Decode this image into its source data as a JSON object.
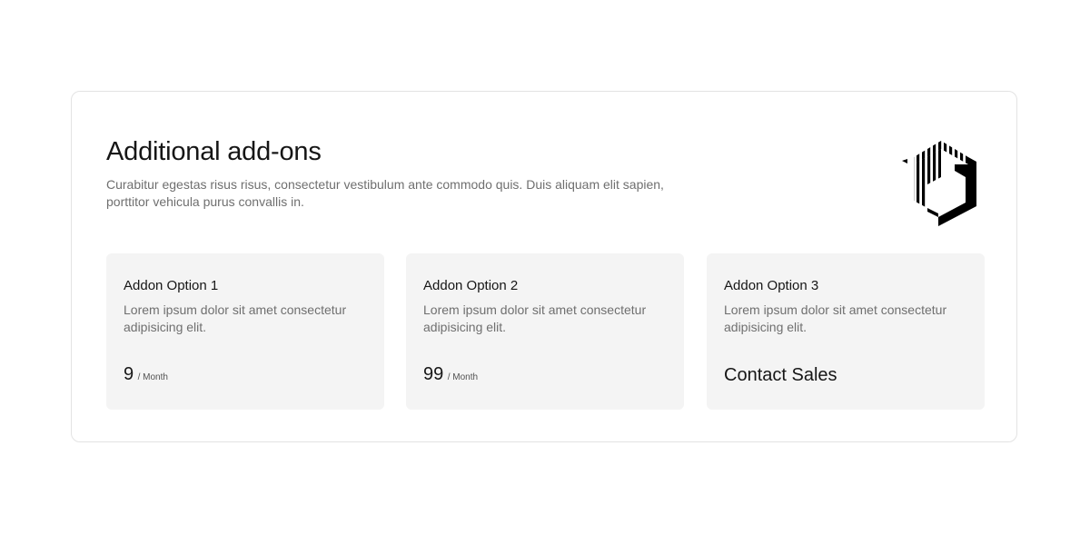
{
  "section": {
    "title": "Additional add-ons",
    "description": "Curabitur egestas risus risus, consectetur vestibulum ante commodo quis. Duis aliquam elit sapien, porttitor vehicula purus convallis in.",
    "logo_icon": "striped-hexagon-logo-icon"
  },
  "addons": [
    {
      "title": "Addon Option 1",
      "description": "Lorem ipsum dolor sit amet consectetur adipisicing elit.",
      "price": "9",
      "price_unit": "/ Month"
    },
    {
      "title": "Addon Option 2",
      "description": "Lorem ipsum dolor sit amet consectetur adipisicing elit.",
      "price": "99",
      "price_unit": "/ Month"
    },
    {
      "title": "Addon Option 3",
      "description": "Lorem ipsum dolor sit amet consectetur adipisicing elit.",
      "cta": "Contact Sales"
    }
  ],
  "colors": {
    "card_background": "#f4f4f4",
    "panel_border": "#e3e3e3",
    "text_primary": "#161616",
    "text_secondary": "#6f6f6f"
  }
}
